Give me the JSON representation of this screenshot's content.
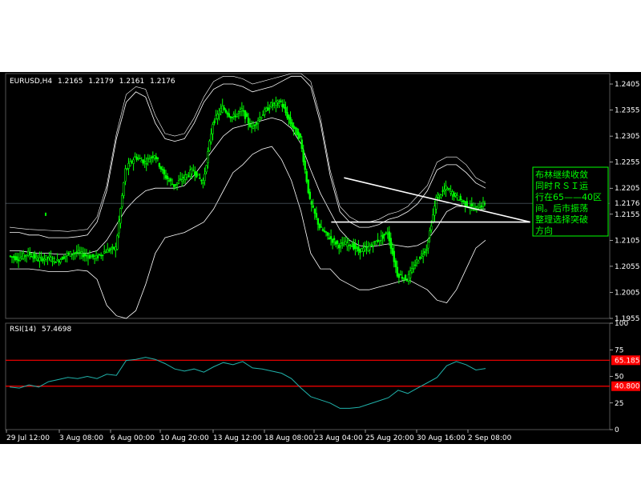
{
  "chart_data": [
    {
      "type": "candlestick",
      "header": {
        "symbol": "EURUSD,H4",
        "open": "1.2165",
        "high": "1.2179",
        "low": "1.2161",
        "close": "1.2176"
      },
      "ylim": [
        1.1955,
        1.2425
      ],
      "y_ticks": [
        "1.2405",
        "1.2355",
        "1.2305",
        "1.2255",
        "1.2205",
        "1.2155",
        "1.2105",
        "1.2055",
        "1.2005",
        "1.1955"
      ],
      "current_price": "1.2176",
      "x_ticks": [
        "29 Jul 12:00",
        "3 Aug 08:00",
        "6 Aug 00:00",
        "10 Aug 20:00",
        "13 Aug 12:00",
        "18 Aug 08:00",
        "23 Aug 04:00",
        "25 Aug 20:00",
        "30 Aug 16:00",
        "2 Sep 08:00"
      ],
      "close_path": [
        1.2075,
        1.207,
        1.208,
        1.2068,
        1.2072,
        1.2065,
        1.2078,
        1.2082,
        1.2075,
        1.2072,
        1.2085,
        1.209,
        1.224,
        1.2265,
        1.2255,
        1.227,
        1.223,
        1.221,
        1.2225,
        1.224,
        1.2215,
        1.233,
        1.236,
        1.234,
        1.2355,
        1.232,
        1.2345,
        1.2365,
        1.237,
        1.233,
        1.23,
        1.218,
        1.213,
        1.211,
        1.2095,
        1.21,
        1.2085,
        1.209,
        1.2105,
        1.212,
        1.204,
        1.203,
        1.2065,
        1.209,
        1.2185,
        1.2205,
        1.219,
        1.2175,
        1.2165,
        1.2176
      ],
      "bb_upper": [
        1.212,
        1.212,
        1.2115,
        1.2115,
        1.211,
        1.211,
        1.211,
        1.2112,
        1.2115,
        1.214,
        1.22,
        1.23,
        1.237,
        1.239,
        1.238,
        1.233,
        1.23,
        1.2295,
        1.23,
        1.233,
        1.237,
        1.2395,
        1.2405,
        1.2405,
        1.24,
        1.239,
        1.2395,
        1.24,
        1.241,
        1.242,
        1.242,
        1.24,
        1.233,
        1.223,
        1.216,
        1.214,
        1.213,
        1.213,
        1.2135,
        1.2145,
        1.215,
        1.216,
        1.2175,
        1.22,
        1.224,
        1.225,
        1.225,
        1.2235,
        1.2215,
        1.2205
      ],
      "bb_middle": [
        1.2085,
        1.2085,
        1.2082,
        1.208,
        1.208,
        1.2078,
        1.2078,
        1.208,
        1.208,
        1.2085,
        1.2105,
        1.2135,
        1.2165,
        1.2185,
        1.22,
        1.2205,
        1.2205,
        1.2205,
        1.221,
        1.223,
        1.2255,
        1.228,
        1.2305,
        1.232,
        1.2325,
        1.233,
        1.2335,
        1.234,
        1.2335,
        1.232,
        1.229,
        1.224,
        1.2195,
        1.216,
        1.2125,
        1.2105,
        1.2095,
        1.2092,
        1.2095,
        1.2098,
        1.2095,
        1.2092,
        1.2095,
        1.2105,
        1.213,
        1.216,
        1.217,
        1.217,
        1.2165,
        1.2165
      ],
      "bb_lower": [
        1.205,
        1.205,
        1.205,
        1.2048,
        1.2045,
        1.2045,
        1.2045,
        1.2048,
        1.2046,
        1.203,
        1.198,
        1.196,
        1.1955,
        1.197,
        1.202,
        1.208,
        1.211,
        1.2115,
        1.212,
        1.213,
        1.214,
        1.2165,
        1.22,
        1.2235,
        1.225,
        1.227,
        1.228,
        1.2285,
        1.226,
        1.222,
        1.216,
        1.208,
        1.205,
        1.205,
        1.203,
        1.202,
        1.201,
        1.201,
        1.2015,
        1.202,
        1.2025,
        1.203,
        1.202,
        1.201,
        1.199,
        1.1985,
        1.201,
        1.205,
        1.209,
        1.2105
      ],
      "bb_outer_upper": [
        1.213,
        1.2128,
        1.2126,
        1.2125,
        1.2124,
        1.2123,
        1.2122,
        1.2124,
        1.2126,
        1.215,
        1.221,
        1.231,
        1.2385,
        1.24,
        1.2395,
        1.2345,
        1.231,
        1.2305,
        1.231,
        1.234,
        1.238,
        1.241,
        1.242,
        1.242,
        1.2415,
        1.2405,
        1.241,
        1.2415,
        1.242,
        1.2425,
        1.2425,
        1.241,
        1.234,
        1.224,
        1.217,
        1.215,
        1.214,
        1.214,
        1.2145,
        1.2155,
        1.216,
        1.217,
        1.219,
        1.221,
        1.2255,
        1.2265,
        1.2265,
        1.225,
        1.2225,
        1.2215
      ],
      "trend_lines": {
        "upper": [
          [
            1.2225,
            0.69
          ],
          [
            1.214,
            0.82
          ]
        ],
        "lower": [
          [
            1.214,
            0.69
          ],
          [
            1.214,
            0.82
          ]
        ]
      },
      "annotation": [
        "布林继续收敛",
        "同时ＲＳＩ运",
        "行在65——40区",
        "间。后市振荡",
        "整理选择突破",
        "方向"
      ]
    },
    {
      "type": "line",
      "header": {
        "name": "RSI(14)",
        "value": "57.4698"
      },
      "ylim": [
        0,
        100
      ],
      "y_ticks": [
        "100",
        "75",
        "50",
        "25",
        "0"
      ],
      "levels": [
        {
          "value": 65.1856,
          "label": "65.185",
          "color": "#ff0000"
        },
        {
          "value": 40.8,
          "label": "40.800",
          "color": "#ff0000"
        }
      ],
      "series": [
        {
          "values": [
            40,
            39,
            42,
            40,
            45,
            47,
            49,
            48,
            50,
            48,
            52,
            51,
            65,
            66,
            68,
            66,
            62,
            57,
            55,
            57,
            54,
            59,
            63,
            61,
            64,
            58,
            57,
            55,
            53,
            48,
            39,
            31,
            28,
            25,
            20,
            20,
            21,
            24,
            27,
            30,
            37,
            34,
            39,
            44,
            49,
            60,
            64,
            61,
            56,
            57.47
          ]
        }
      ]
    }
  ],
  "colors": {
    "background": "#000000",
    "candle": "#00ff00",
    "bands": "#ffffff",
    "rsi_line": "#20b2aa",
    "rsi_levels": "#ff0000",
    "trend_lines": "#ffffff",
    "annotation_box_border": "#00ff00"
  }
}
